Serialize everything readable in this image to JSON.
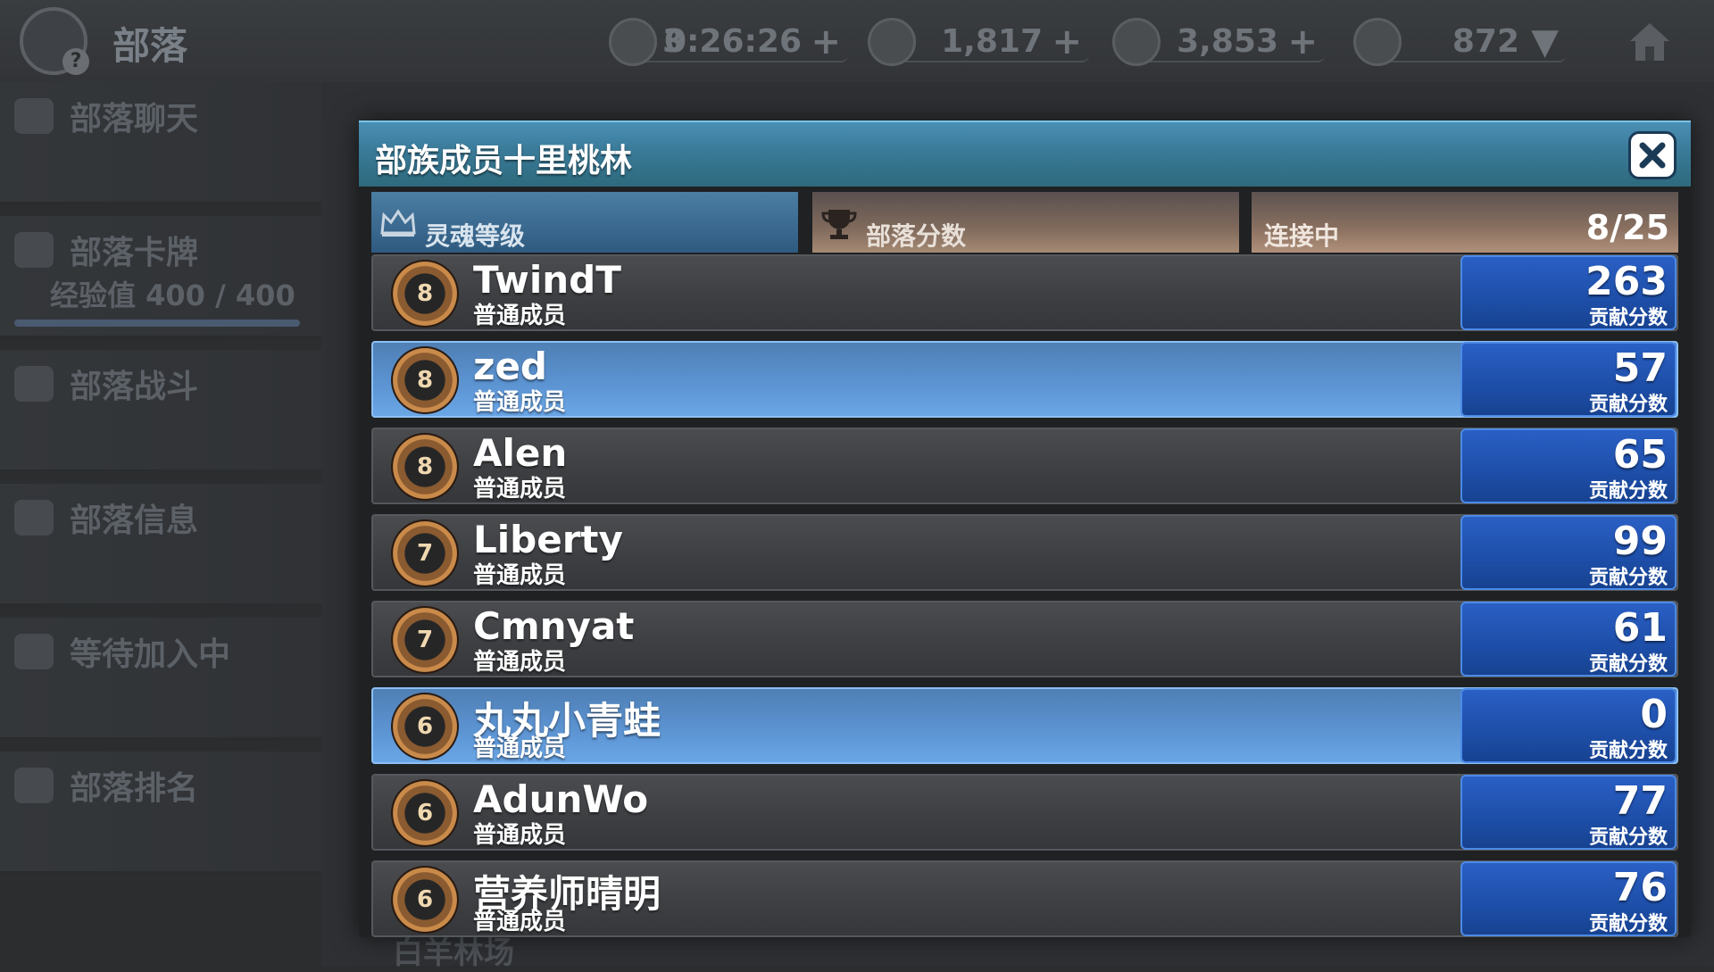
{
  "topbar": {
    "title": "部落",
    "timer": {
      "count": "3",
      "value": "0:26:26"
    },
    "resource1": "1,817",
    "resource2": "3,853",
    "trophies": "872"
  },
  "sidebar": {
    "items": [
      {
        "label": "部落聊天"
      },
      {
        "label": "部落卡牌",
        "sub": "经验值 400 / 400"
      },
      {
        "label": "部落战斗"
      },
      {
        "label": "部落信息"
      },
      {
        "label": "等待加入中"
      },
      {
        "label": "部落排名"
      }
    ]
  },
  "background": {
    "bottom_text": "白羊林场"
  },
  "modal": {
    "title": "部族成员十里桃林",
    "tabs": {
      "soul": "灵魂等级",
      "score": "部落分数",
      "online": "连接中",
      "online_count": "8/25"
    },
    "members": [
      {
        "level": "8",
        "name": "TwindT",
        "role": "普通成员",
        "score": "263",
        "score_label": "贡献分数",
        "highlight": false
      },
      {
        "level": "8",
        "name": "zed",
        "role": "普通成员",
        "score": "57",
        "score_label": "贡献分数",
        "highlight": true
      },
      {
        "level": "8",
        "name": "Alen",
        "role": "普通成员",
        "score": "65",
        "score_label": "贡献分数",
        "highlight": false
      },
      {
        "level": "7",
        "name": "Liberty",
        "role": "普通成员",
        "score": "99",
        "score_label": "贡献分数",
        "highlight": false
      },
      {
        "level": "7",
        "name": "Cmnyat",
        "role": "普通成员",
        "score": "61",
        "score_label": "贡献分数",
        "highlight": false
      },
      {
        "level": "6",
        "name": "丸丸小青蛙",
        "role": "普通成员",
        "score": "0",
        "score_label": "贡献分数",
        "highlight": true
      },
      {
        "level": "6",
        "name": "AdunWo",
        "role": "普通成员",
        "score": "77",
        "score_label": "贡献分数",
        "highlight": false
      },
      {
        "level": "6",
        "name": "营养师晴明",
        "role": "普通成员",
        "score": "76",
        "score_label": "贡献分数",
        "highlight": false
      }
    ]
  },
  "colors": {
    "header_accent": "#3a7a98",
    "highlight_row": "#5a91cf",
    "contribution_box": "#1d4ea8"
  }
}
